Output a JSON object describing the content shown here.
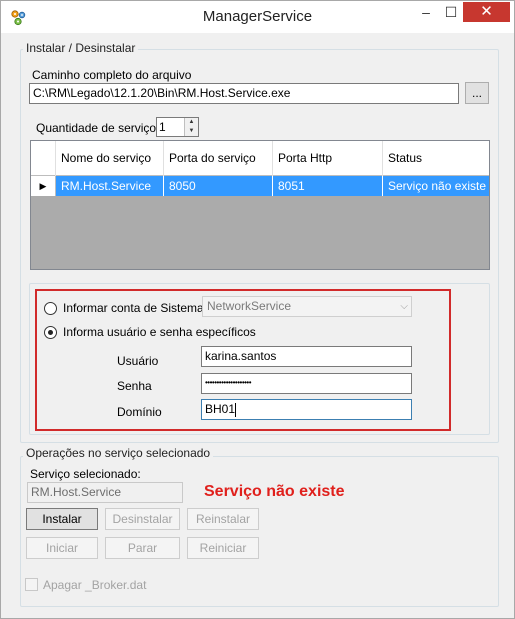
{
  "window": {
    "title": "ManagerService",
    "minimize_glyph": "–",
    "maximize_glyph": "☐",
    "close_glyph": "✕",
    "app_icon": "gear-cluster-icon"
  },
  "install_group": {
    "legend": "Instalar / Desinstalar",
    "path_label": "Caminho completo do arquivo",
    "path_value": "C:\\RM\\Legado\\12.1.20\\Bin\\RM.Host.Service.exe",
    "browse_label": "...",
    "quantity_label": "Quantidade de serviços",
    "quantity_value": "1"
  },
  "grid": {
    "columns": [
      "Nome do serviço",
      "Porta do serviço",
      "Porta Http",
      "Status"
    ],
    "rows": [
      [
        "RM.Host.Service",
        "8050",
        "8051",
        "Serviço não existe"
      ]
    ],
    "current_row_marker": "▶",
    "selection_color": "#3399ff"
  },
  "account": {
    "system_account_label": "Informar conta de Sistema",
    "system_account_value": "NetworkService",
    "specific_user_label": "Informa usuário e senha específicos",
    "specific_user_selected": true,
    "user_label": "Usuário",
    "user_value": "karina.santos",
    "password_label": "Senha",
    "password_value": "••••••••••••••••••••",
    "domain_label": "Domínio",
    "domain_value": "BH01",
    "highlight_color": "#d12a2a"
  },
  "operations": {
    "legend": "Operações no serviço selecionado",
    "selected_label": "Serviço selecionado:",
    "selected_value": "RM.Host.Service",
    "status_message": "Serviço não existe",
    "status_color": "#e0201c",
    "buttons": {
      "install": "Instalar",
      "uninstall": "Desinstalar",
      "reinstall": "Reinstalar",
      "start": "Iniciar",
      "stop": "Parar",
      "restart": "Reiniciar"
    },
    "delete_broker_label": "Apagar _Broker.dat"
  }
}
